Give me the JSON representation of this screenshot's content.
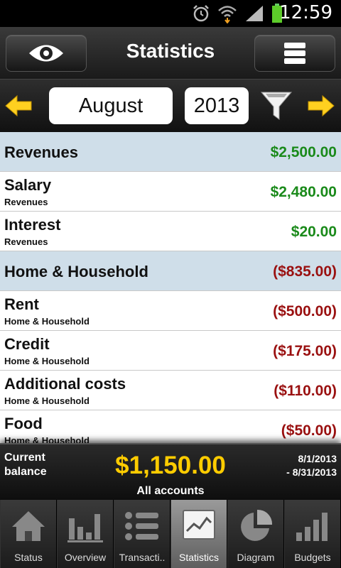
{
  "status_bar": {
    "time": "12:59"
  },
  "header": {
    "title": "Statistics",
    "left_icon": "eye-icon",
    "right_icon": "menu-icon"
  },
  "period": {
    "month": "August",
    "year": "2013"
  },
  "rows": [
    {
      "type": "group",
      "name": "Revenues",
      "amount": "$2,500.00",
      "sign": "pos"
    },
    {
      "type": "item",
      "name": "Salary",
      "category": "Revenues",
      "amount": "$2,480.00",
      "sign": "pos"
    },
    {
      "type": "item",
      "name": "Interest",
      "category": "Revenues",
      "amount": "$20.00",
      "sign": "pos"
    },
    {
      "type": "group",
      "name": "Home & Household",
      "amount": "($835.00)",
      "sign": "neg"
    },
    {
      "type": "item",
      "name": "Rent",
      "category": "Home & Household",
      "amount": "($500.00)",
      "sign": "neg"
    },
    {
      "type": "item",
      "name": "Credit",
      "category": "Home & Household",
      "amount": "($175.00)",
      "sign": "neg"
    },
    {
      "type": "item",
      "name": "Additional costs",
      "category": "Home & Household",
      "amount": "($110.00)",
      "sign": "neg"
    },
    {
      "type": "item",
      "name": "Food",
      "category": "Home & Household",
      "amount": "($50.00)",
      "sign": "neg"
    }
  ],
  "balance": {
    "label_line1": "Current",
    "label_line2": "balance",
    "value": "$1,150.00",
    "date_from": "8/1/2013",
    "date_to": "- 8/31/2013",
    "accounts": "All accounts"
  },
  "tabs": [
    {
      "label": "Status",
      "icon": "home-icon"
    },
    {
      "label": "Overview",
      "icon": "bar-chart-icon"
    },
    {
      "label": "Transacti..",
      "icon": "list-icon"
    },
    {
      "label": "Statistics",
      "icon": "line-chart-icon",
      "active": true
    },
    {
      "label": "Diagram",
      "icon": "pie-chart-icon"
    },
    {
      "label": "Budgets",
      "icon": "budget-bars-icon"
    }
  ],
  "colors": {
    "positive": "#1a8a1a",
    "negative": "#9a1010",
    "balance": "#ffcc00",
    "group_bg": "#cfdee9"
  }
}
